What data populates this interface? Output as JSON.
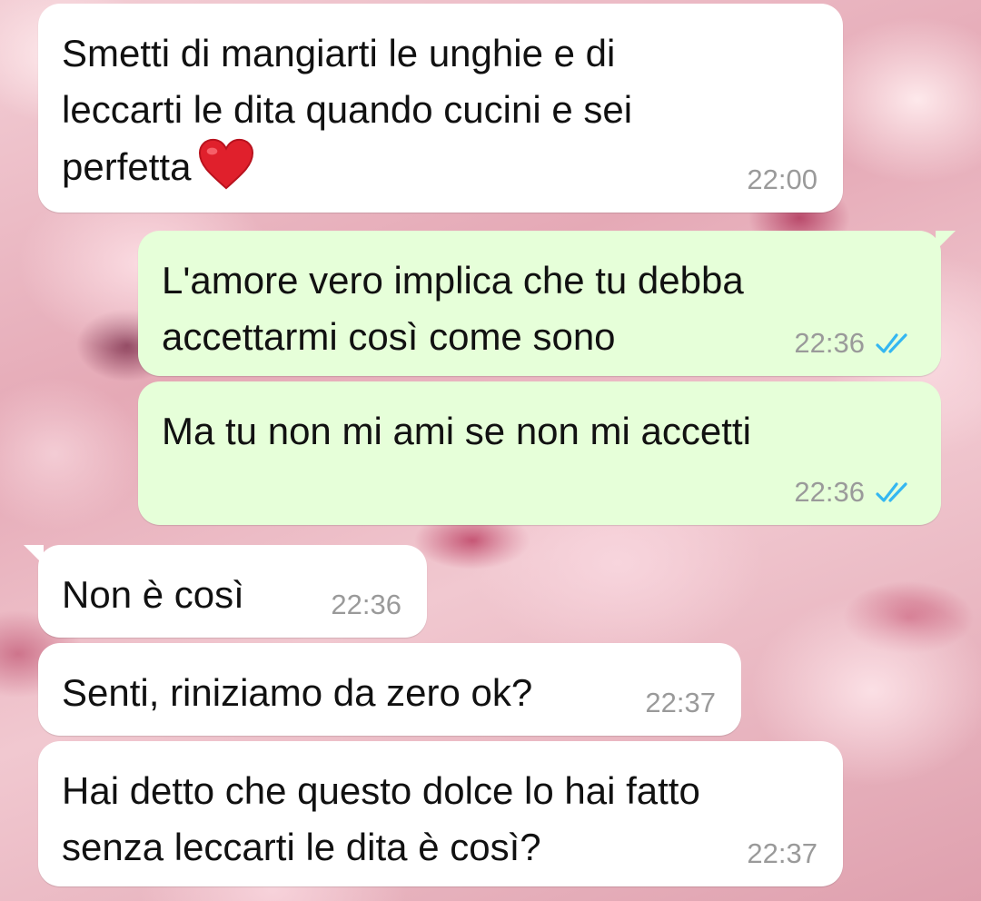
{
  "conversation": {
    "messages": [
      {
        "direction": "incoming",
        "text": "Smetti di mangiarti le unghie e di\nleccarti le dita quando cucini e sei\nperfetta",
        "emoji": "red-heart-emoji",
        "time": "22:00"
      },
      {
        "direction": "outgoing",
        "text": "L'amore vero implica che tu debba\naccettarmi così come sono",
        "time": "22:36",
        "status_icon": "double-check-read-icon"
      },
      {
        "direction": "outgoing",
        "text": "Ma tu non mi ami se non mi accetti",
        "time": "22:36",
        "status_icon": "double-check-read-icon"
      },
      {
        "direction": "incoming",
        "text": "Non è così",
        "time": "22:36"
      },
      {
        "direction": "incoming",
        "text": "Senti, riniziamo da zero ok?",
        "time": "22:37"
      },
      {
        "direction": "incoming",
        "text": "Hai detto che questo dolce lo hai fatto\nsenza leccarti le dita è così?",
        "time": "22:37"
      }
    ]
  },
  "colors": {
    "incoming_bubble": "#ffffff",
    "outgoing_bubble": "#e6ffd9",
    "timestamp": "#9a9a9a",
    "read_tick": "#34b7f1",
    "heart": "#e0202c"
  }
}
